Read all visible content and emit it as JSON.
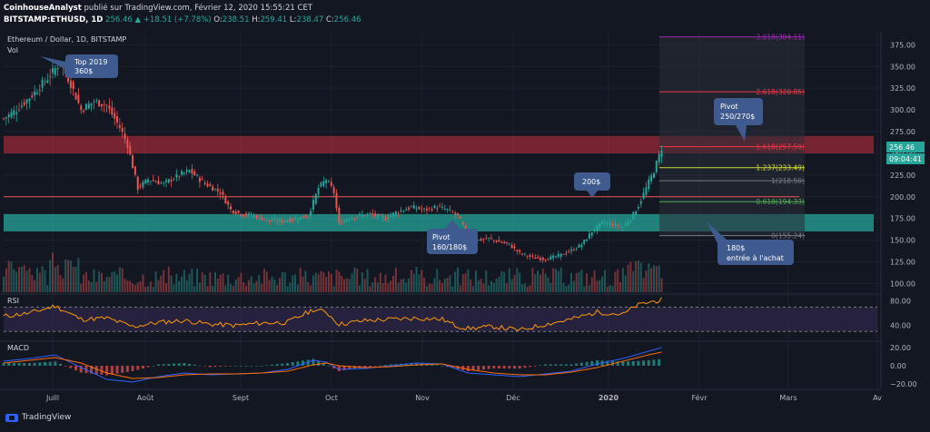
{
  "header": {
    "author": "CoinhouseAnalyst",
    "published": "publié sur TradingView.com, Février 12, 2020 15:55:21 CET",
    "symbol": "BITSTAMP:ETHUSD, 1D",
    "last": "256.46",
    "change": "▲ +18.51 (+7.78%)",
    "o_label": "O:",
    "o_value": "238.51",
    "h_label": "H:",
    "h_value": "259.41",
    "l_label": "L:",
    "l_value": "238.47",
    "c_label": "C:",
    "c_value": "256.46"
  },
  "legend": {
    "title": "Ethereum / Dollar, 1D, BITSTAMP",
    "vol": "Vol",
    "rsi": "RSI",
    "macd": "MACD"
  },
  "footer": {
    "brand": "TradingView"
  },
  "price_badge": {
    "value": "256.46",
    "timer": "09:04:41",
    "color": "#26a69a"
  },
  "annotations": [
    {
      "id": "top2019",
      "line1": "Top 2019",
      "line2": "360$"
    },
    {
      "id": "pivot160",
      "line1": "Pivot",
      "line2": "160/180$"
    },
    {
      "id": "p200",
      "line1": "200$",
      "line2": ""
    },
    {
      "id": "pivot250",
      "line1": "Pivot",
      "line2": "250/270$"
    },
    {
      "id": "entry180",
      "line1": "180$",
      "line2": "entrée à l'achat"
    }
  ],
  "fib_levels": [
    {
      "ratio": "3.618",
      "value": 384.11,
      "color": "#9c27b0"
    },
    {
      "ratio": "2.618",
      "value": 320.85,
      "color": "#f23645"
    },
    {
      "ratio": "1.618",
      "value": 257.59,
      "color": "#f23645"
    },
    {
      "ratio": "1.237",
      "value": 233.49,
      "color": "#cddc39"
    },
    {
      "ratio": "1",
      "value": 218.5,
      "color": "#787b86"
    },
    {
      "ratio": "0.618",
      "value": 194.33,
      "color": "#4caf50"
    },
    {
      "ratio": "0",
      "value": 155.24,
      "color": "#787b86"
    }
  ],
  "colors": {
    "up": "#26a69a",
    "down": "#ef5350",
    "bg": "#131722",
    "annotation": "#3e5a8f"
  },
  "chart_data": {
    "type": "candlestick",
    "title": "Ethereum / Dollar, 1D, BITSTAMP",
    "price_axis": {
      "ticks": [
        100,
        125,
        150,
        175,
        200,
        225,
        250,
        275,
        300,
        325,
        350,
        375
      ],
      "ylim": [
        90,
        390
      ]
    },
    "rsi_axis": {
      "ticks": [
        40,
        80
      ]
    },
    "macd_axis": {
      "ticks": [
        20,
        0,
        -20
      ],
      "labels": [
        "20.00",
        "0.00",
        "−20.00"
      ]
    },
    "time_labels": [
      "Juill",
      "Août",
      "Sept",
      "Oct",
      "Nov",
      "Déc",
      "2020",
      "Févr",
      "Mars",
      "Av"
    ],
    "zones": [
      {
        "name": "resistance",
        "from": 250,
        "to": 270,
        "color": "#f23645"
      },
      {
        "name": "support",
        "from": 160,
        "to": 180,
        "color": "#26a69a"
      }
    ],
    "price_path": [
      [
        0,
        290
      ],
      [
        5,
        300
      ],
      [
        12,
        320
      ],
      [
        18,
        340
      ],
      [
        22,
        355
      ],
      [
        26,
        330
      ],
      [
        30,
        300
      ],
      [
        35,
        310
      ],
      [
        40,
        305
      ],
      [
        45,
        280
      ],
      [
        48,
        260
      ],
      [
        52,
        210
      ],
      [
        56,
        220
      ],
      [
        62,
        215
      ],
      [
        68,
        225
      ],
      [
        72,
        230
      ],
      [
        78,
        215
      ],
      [
        84,
        205
      ],
      [
        88,
        185
      ],
      [
        92,
        180
      ],
      [
        97,
        178
      ],
      [
        103,
        172
      ],
      [
        108,
        172
      ],
      [
        114,
        175
      ],
      [
        118,
        178
      ],
      [
        122,
        210
      ],
      [
        125,
        220
      ],
      [
        128,
        205
      ],
      [
        130,
        168
      ],
      [
        133,
        175
      ],
      [
        137,
        178
      ],
      [
        142,
        180
      ],
      [
        148,
        175
      ],
      [
        152,
        182
      ],
      [
        158,
        188
      ],
      [
        163,
        185
      ],
      [
        168,
        188
      ],
      [
        172,
        185
      ],
      [
        176,
        178
      ],
      [
        180,
        155
      ],
      [
        184,
        150
      ],
      [
        188,
        152
      ],
      [
        192,
        148
      ],
      [
        196,
        145
      ],
      [
        200,
        135
      ],
      [
        205,
        130
      ],
      [
        210,
        128
      ],
      [
        215,
        132
      ],
      [
        220,
        138
      ],
      [
        224,
        145
      ],
      [
        228,
        160
      ],
      [
        232,
        170
      ],
      [
        236,
        168
      ],
      [
        240,
        165
      ],
      [
        243,
        175
      ],
      [
        246,
        190
      ],
      [
        249,
        210
      ],
      [
        252,
        230
      ],
      [
        255,
        256
      ]
    ],
    "rsi_path": [
      [
        0,
        55
      ],
      [
        10,
        60
      ],
      [
        20,
        72
      ],
      [
        30,
        50
      ],
      [
        40,
        52
      ],
      [
        50,
        38
      ],
      [
        60,
        45
      ],
      [
        70,
        48
      ],
      [
        80,
        42
      ],
      [
        90,
        40
      ],
      [
        100,
        44
      ],
      [
        110,
        45
      ],
      [
        120,
        66
      ],
      [
        125,
        62
      ],
      [
        130,
        42
      ],
      [
        140,
        48
      ],
      [
        150,
        50
      ],
      [
        160,
        52
      ],
      [
        170,
        50
      ],
      [
        175,
        40
      ],
      [
        180,
        35
      ],
      [
        190,
        38
      ],
      [
        200,
        32
      ],
      [
        210,
        42
      ],
      [
        220,
        50
      ],
      [
        230,
        62
      ],
      [
        240,
        58
      ],
      [
        245,
        72
      ],
      [
        250,
        78
      ],
      [
        255,
        82
      ]
    ],
    "macd_line": [
      [
        0,
        5
      ],
      [
        10,
        8
      ],
      [
        20,
        12
      ],
      [
        30,
        -2
      ],
      [
        40,
        -15
      ],
      [
        50,
        -18
      ],
      [
        60,
        -12
      ],
      [
        70,
        -8
      ],
      [
        80,
        -10
      ],
      [
        90,
        -9
      ],
      [
        100,
        -8
      ],
      [
        110,
        -4
      ],
      [
        120,
        6
      ],
      [
        125,
        4
      ],
      [
        130,
        -4
      ],
      [
        140,
        -3
      ],
      [
        150,
        0
      ],
      [
        160,
        3
      ],
      [
        170,
        2
      ],
      [
        180,
        -8
      ],
      [
        190,
        -10
      ],
      [
        200,
        -12
      ],
      [
        210,
        -9
      ],
      [
        220,
        -6
      ],
      [
        230,
        2
      ],
      [
        240,
        8
      ],
      [
        250,
        16
      ],
      [
        255,
        20
      ]
    ],
    "signal_line": [
      [
        0,
        3
      ],
      [
        10,
        6
      ],
      [
        20,
        9
      ],
      [
        30,
        3
      ],
      [
        40,
        -8
      ],
      [
        50,
        -14
      ],
      [
        60,
        -13
      ],
      [
        70,
        -10
      ],
      [
        80,
        -9
      ],
      [
        90,
        -9
      ],
      [
        100,
        -8
      ],
      [
        110,
        -6
      ],
      [
        120,
        1
      ],
      [
        125,
        3
      ],
      [
        130,
        0
      ],
      [
        140,
        -2
      ],
      [
        150,
        -1
      ],
      [
        160,
        1
      ],
      [
        170,
        2
      ],
      [
        180,
        -4
      ],
      [
        190,
        -8
      ],
      [
        200,
        -10
      ],
      [
        210,
        -10
      ],
      [
        220,
        -7
      ],
      [
        230,
        -2
      ],
      [
        240,
        5
      ],
      [
        250,
        12
      ],
      [
        255,
        15
      ]
    ]
  }
}
